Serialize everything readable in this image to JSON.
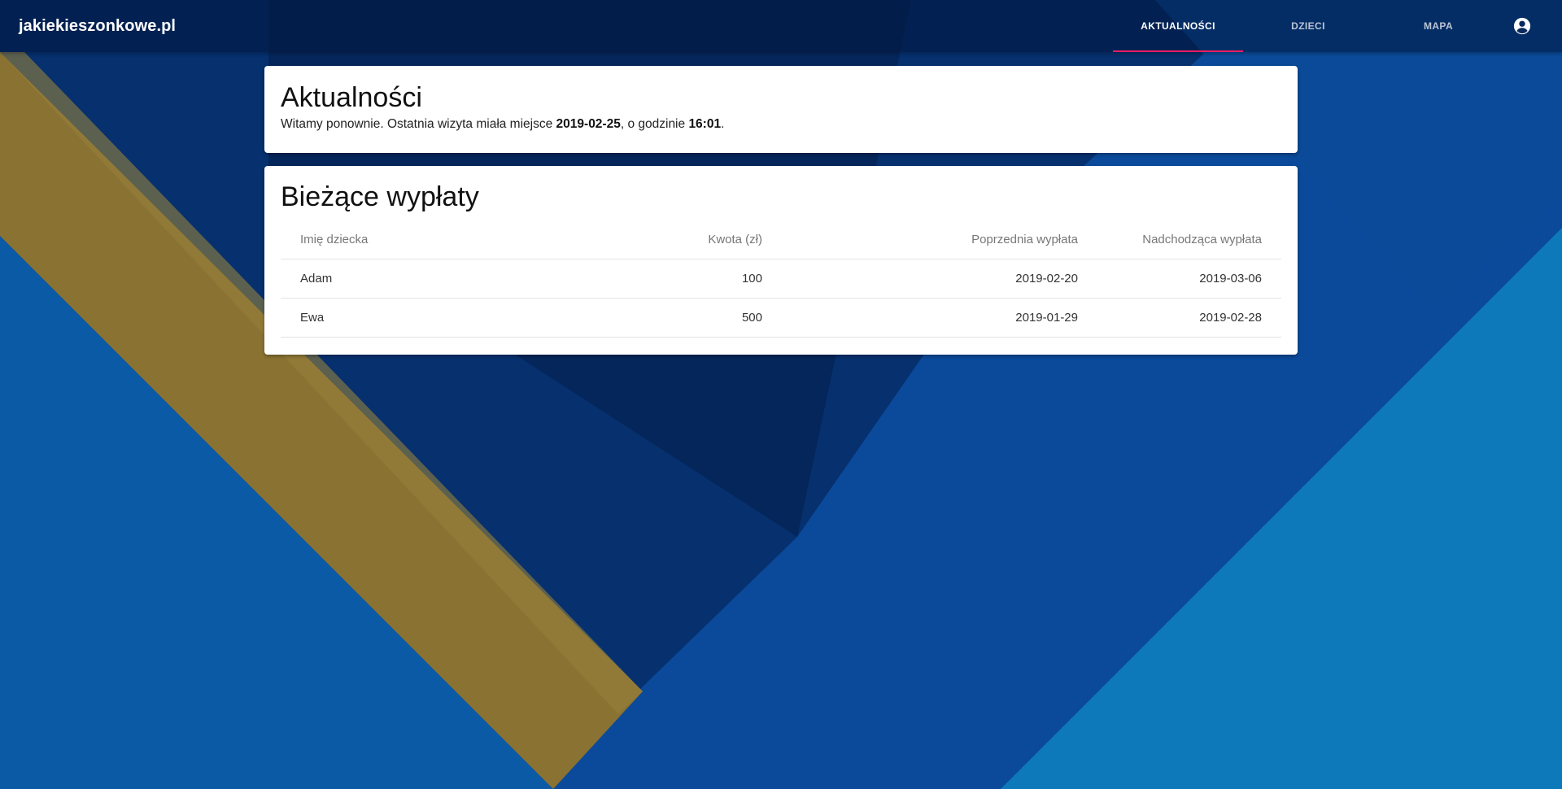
{
  "app": {
    "brand": "jakiekieszonkowe.pl"
  },
  "nav": {
    "items": [
      {
        "label": "AKTUALNOŚCI",
        "active": true
      },
      {
        "label": "DZIECI",
        "active": false
      },
      {
        "label": "MAPA",
        "active": false
      }
    ],
    "account_icon": "account-circle-icon"
  },
  "news": {
    "title": "Aktualności",
    "welcome_prefix": "Witamy ponownie. Ostatnia wizyta miała miejsce ",
    "last_visit_date": "2019-02-25",
    "welcome_middle": ", o godzinie ",
    "last_visit_time": "16:01",
    "welcome_suffix": "."
  },
  "payouts": {
    "title": "Bieżące wypłaty",
    "columns": [
      "Imię dziecka",
      "Kwota (zł)",
      "Poprzednia wypłata",
      "Nadchodząca wypłata"
    ],
    "rows": [
      [
        "Adam",
        "100",
        "2019-02-20",
        "2019-03-06"
      ],
      [
        "Ewa",
        "500",
        "2019-01-29",
        "2019-02-28"
      ]
    ]
  },
  "colors": {
    "accent": "#e91e63",
    "background": "#0a3a7a",
    "gold_stripe": "#8a7232"
  }
}
